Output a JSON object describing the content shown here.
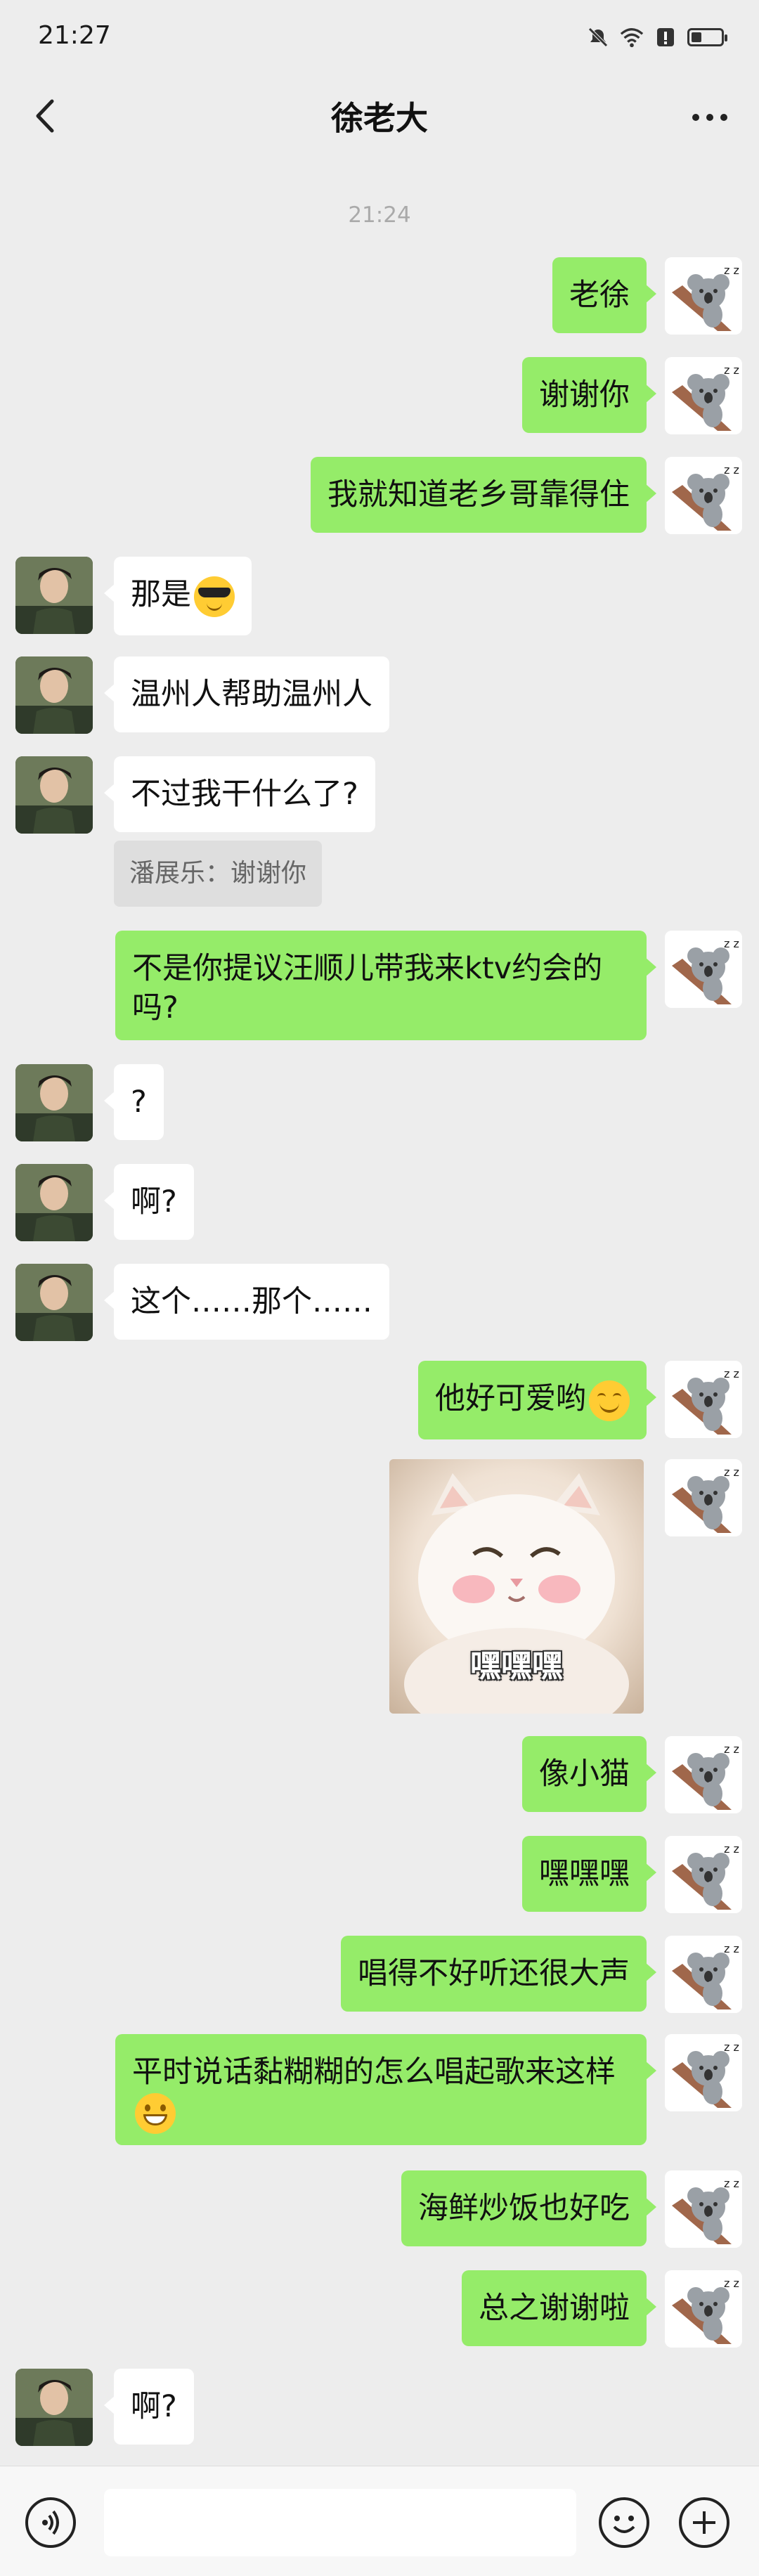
{
  "status_bar": {
    "time": "21:27",
    "icons": [
      "mute-icon",
      "wifi-icon",
      "alert-icon",
      "battery-icon"
    ]
  },
  "header": {
    "title": "徐老大",
    "back_icon": "chevron-left-icon",
    "more_icon": "more-dots-icon"
  },
  "chat": {
    "timestamp": "21:24",
    "messages": [
      {
        "from": "me",
        "text": "老徐"
      },
      {
        "from": "me",
        "text": "谢谢你"
      },
      {
        "from": "me",
        "text": "我就知道老乡哥靠得住"
      },
      {
        "from": "other",
        "text": "那是",
        "emoji": "sunglasses-emoji"
      },
      {
        "from": "other",
        "text": "温州人帮助温州人"
      },
      {
        "from": "other",
        "text": "不过我干什么了?"
      },
      {
        "from": "quote",
        "text": "潘展乐：谢谢你"
      },
      {
        "from": "me",
        "text": "不是你提议汪顺儿带我来ktv约会的吗?"
      },
      {
        "from": "other",
        "text": "?"
      },
      {
        "from": "other",
        "text": "啊?"
      },
      {
        "from": "other",
        "text": "这个……那个……"
      },
      {
        "from": "me",
        "text": "他好可爱哟",
        "emoji": "smile-emoji"
      },
      {
        "from": "me",
        "sticker_text": "嘿嘿嘿",
        "sticker": "white-kitten-sticker"
      },
      {
        "from": "me",
        "text": "像小猫"
      },
      {
        "from": "me",
        "text": "嘿嘿嘿"
      },
      {
        "from": "me",
        "text": "唱得不好听还很大声"
      },
      {
        "from": "me",
        "text": "平时说话黏糊糊的怎么唱起歌来这样",
        "emoji": "grin-emoji"
      },
      {
        "from": "me",
        "text": "海鲜炒饭也好吃"
      },
      {
        "from": "me",
        "text": "总之谢谢啦"
      },
      {
        "from": "other",
        "text": "啊?"
      }
    ]
  },
  "input_bar": {
    "voice_icon": "voice-icon",
    "emoji_icon": "emoji-icon",
    "plus_icon": "plus-icon",
    "input_value": ""
  },
  "colors": {
    "background": "#ededed",
    "outgoing_bubble": "#95ec69",
    "incoming_bubble": "#ffffff"
  }
}
